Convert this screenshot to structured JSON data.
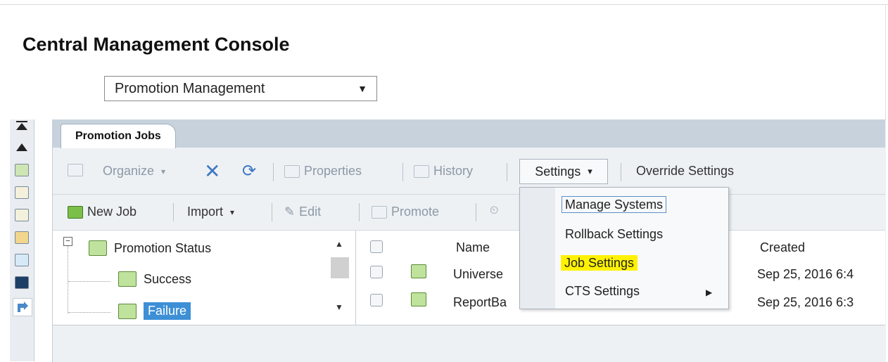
{
  "app_title": "Central Management Console",
  "app_selector": {
    "value": "Promotion Management"
  },
  "tab": {
    "label": "Promotion Jobs"
  },
  "toolbar1": {
    "organize": "Organize",
    "properties": "Properties",
    "history": "History",
    "settings": "Settings",
    "override_settings": "Override Settings"
  },
  "toolbar2": {
    "new_job": "New Job",
    "import": "Import",
    "edit": "Edit",
    "promote": "Promote"
  },
  "tree": {
    "root": "Promotion Status",
    "children": [
      "Success",
      "Failure"
    ]
  },
  "list": {
    "columns": {
      "name": "Name",
      "created": "Created"
    },
    "rows": [
      {
        "name": "Universe",
        "created": "Sep 25, 2016 6:4"
      },
      {
        "name": "ReportBa",
        "created": "Sep 25, 2016 6:3"
      }
    ]
  },
  "settings_menu": {
    "items": [
      "Manage Systems",
      "Rollback Settings",
      "Job Settings",
      "CTS Settings"
    ]
  },
  "colors": {
    "title_bar": "#c7d2dc",
    "panel_bg": "#eef1f4",
    "selection": "#3d8fd6",
    "highlight": "#fff200"
  }
}
